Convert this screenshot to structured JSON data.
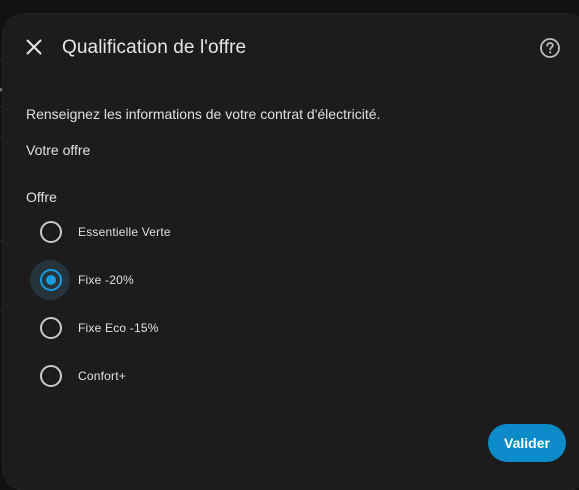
{
  "dialog": {
    "title": "Qualification de l'offre",
    "description": "Renseignez les informations de votre contrat d'électricité.",
    "section_title": "Votre offre",
    "close_icon": "close-icon",
    "help_icon": "help-circle-icon"
  },
  "offer_group": {
    "label": "Offre",
    "selected": "Fixe -20%",
    "options": [
      {
        "label": "Essentielle Verte",
        "checked": false
      },
      {
        "label": "Fixe -20%",
        "checked": true
      },
      {
        "label": "Fixe Eco -15%",
        "checked": false
      },
      {
        "label": "Confort+",
        "checked": false
      }
    ]
  },
  "actions": {
    "submit_label": "Valider"
  },
  "colors": {
    "accent": "#1a9be0",
    "button": "#0b8bc7",
    "dialog_bg": "#1c1c1c",
    "text": "#e0e0e0"
  },
  "backdrop": {
    "edge_glyph": "x"
  }
}
